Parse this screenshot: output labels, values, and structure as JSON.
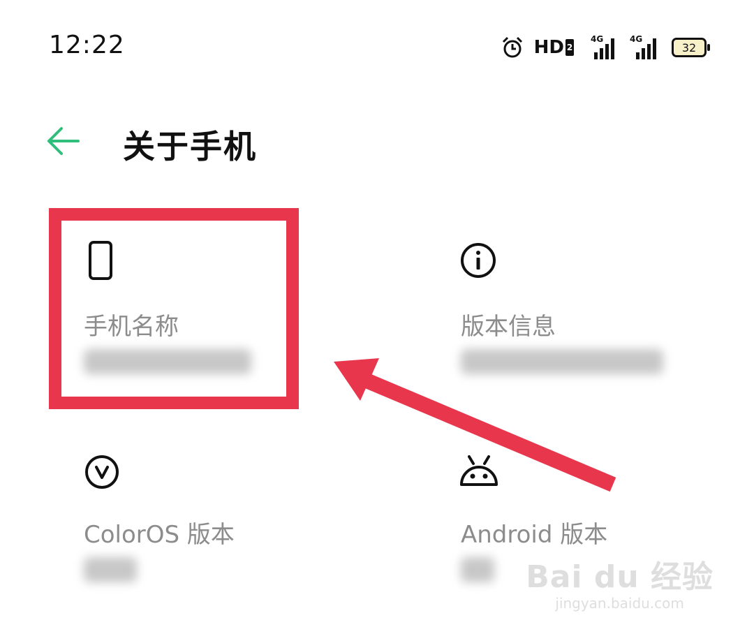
{
  "status_bar": {
    "time": "12:22",
    "hd_label": "HD",
    "hd_sub": "2",
    "signal_labels": [
      "4G",
      "4G"
    ],
    "battery_level": "32"
  },
  "header": {
    "title": "关于手机",
    "back_icon": "back-arrow-icon",
    "accent_color": "#2fbe7c"
  },
  "cells": [
    {
      "icon": "phone-icon",
      "label": "手机名称"
    },
    {
      "icon": "info-icon",
      "label": "版本信息"
    },
    {
      "icon": "coloros-v-icon",
      "label": "ColorOS 版本"
    },
    {
      "icon": "android-icon",
      "label": "Android 版本"
    }
  ],
  "annotation": {
    "color": "#e8364d"
  },
  "watermark": {
    "logo": "Bai du 经验",
    "url": "jingyan.baidu.com"
  }
}
